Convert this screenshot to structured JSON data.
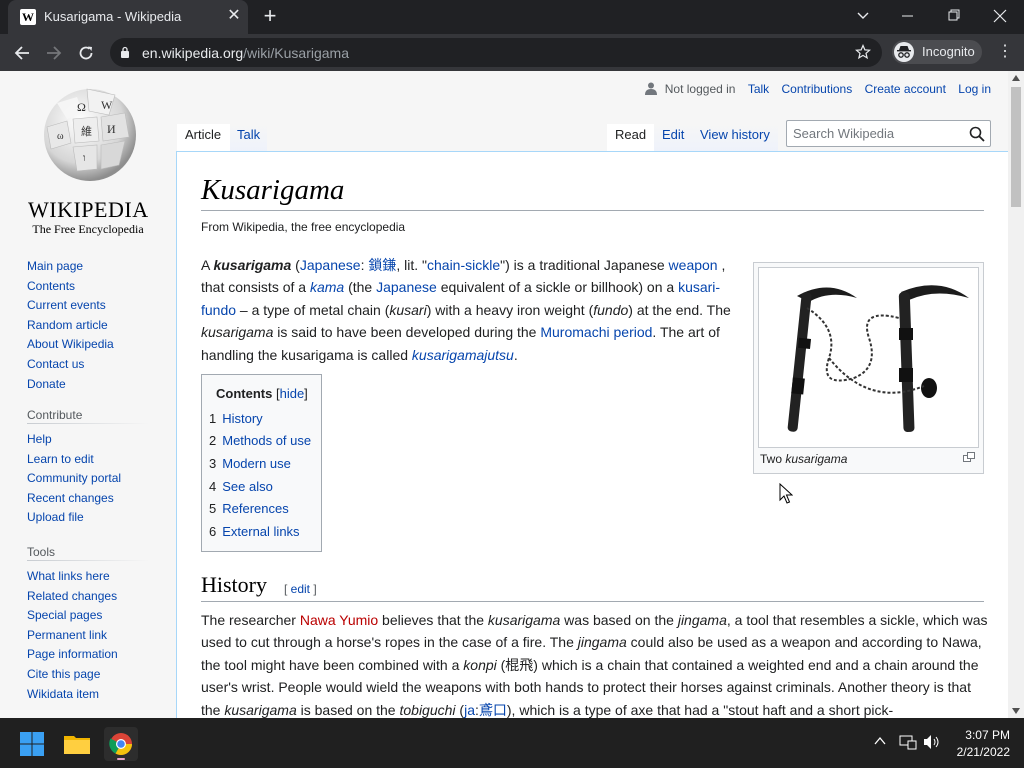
{
  "browser": {
    "tab_title": "Kusarigama - Wikipedia",
    "tab_favicon": "W",
    "url_host": "en.wikipedia.org",
    "url_path": "/wiki/Kusarigama",
    "incognito_label": "Incognito"
  },
  "wiki": {
    "logo_wordmark": "WIKIPEDIA",
    "logo_tagline": "The Free Encyclopedia",
    "user_nav": [
      "Not logged in",
      "Talk",
      "Contributions",
      "Create account",
      "Log in"
    ],
    "left_tabs": [
      "Article",
      "Talk"
    ],
    "right_tabs": [
      "Read",
      "Edit",
      "View history"
    ],
    "search_placeholder": "Search Wikipedia",
    "nav_links": [
      "Main page",
      "Contents",
      "Current events",
      "Random article",
      "About Wikipedia",
      "Contact us",
      "Donate"
    ],
    "contribute_heading": "Contribute",
    "contribute_links": [
      "Help",
      "Learn to edit",
      "Community portal",
      "Recent changes",
      "Upload file"
    ],
    "tools_heading": "Tools",
    "tools_links": [
      "What links here",
      "Related changes",
      "Special pages",
      "Permanent link",
      "Page information",
      "Cite this page",
      "Wikidata item"
    ]
  },
  "article": {
    "title": "Kusarigama",
    "from": "From Wikipedia, the free encyclopedia",
    "lead": {
      "a": "A ",
      "term": "kusarigama",
      "b": " (",
      "japanese_link": "Japanese",
      "c": ": ",
      "kanji": "鎖鎌",
      "d": ", lit. \"",
      "chain_sickle": "chain-sickle",
      "e": "\") is a traditional Japanese ",
      "weapon": "weapon",
      "f": " , that consists of a ",
      "kama": "kama",
      "g": " (the ",
      "japanese2": "Japanese",
      "h": " equivalent of a sickle or billhook) on a ",
      "kusari_fundo": "kusari-fundo",
      "i": " – a type of metal chain (",
      "kusari": "kusari",
      "j": ") with a heavy iron weight (",
      "fundo": "fundo",
      "k": ") at the end. The ",
      "term2": "kusarigama",
      "l": " is said to have been developed during the ",
      "muromachi": "Muromachi period",
      "m": ". The art of handling the kusarigama is called ",
      "jutsu": "kusarigamajutsu",
      "n": "."
    },
    "infobox_caption_a": "Two ",
    "infobox_caption_b": "kusarigama",
    "toc": {
      "title": "Contents",
      "hide": "hide",
      "items": [
        {
          "num": "1",
          "label": "History"
        },
        {
          "num": "2",
          "label": "Methods of use"
        },
        {
          "num": "3",
          "label": "Modern use"
        },
        {
          "num": "4",
          "label": "See also"
        },
        {
          "num": "5",
          "label": "References"
        },
        {
          "num": "6",
          "label": "External links"
        }
      ]
    },
    "history_heading": "History",
    "history_edit": "edit",
    "history": {
      "a": "The researcher ",
      "nawa": "Nawa Yumio",
      "b": " believes that the ",
      "term": "kusarigama",
      "c": " was based on the ",
      "jingama": "jingama",
      "d": ", a tool that resembles a sickle, which was used to cut through a horse's ropes in the case of a fire. The ",
      "jingama2": "jingama",
      "e": " could also be used as a weapon and according to Nawa, the tool might have been combined with a ",
      "konpi": "konpi",
      "f": " (棍飛) which is a chain that contained a weighted end and a chain around the user's wrist. People would wield the weapons with both hands to protect their horses against criminals. Another theory is that the ",
      "term2": "kusarigama",
      "g": " is based on the ",
      "tobiguchi": "tobiguchi",
      "h": " (",
      "ja": "ja",
      "i": ":",
      "ja_kanji": "鳶口",
      "j": "), which is a type of axe that had a \"stout haft and a short pick-"
    }
  },
  "taskbar": {
    "time": "3:07 PM",
    "date": "2/21/2022"
  }
}
